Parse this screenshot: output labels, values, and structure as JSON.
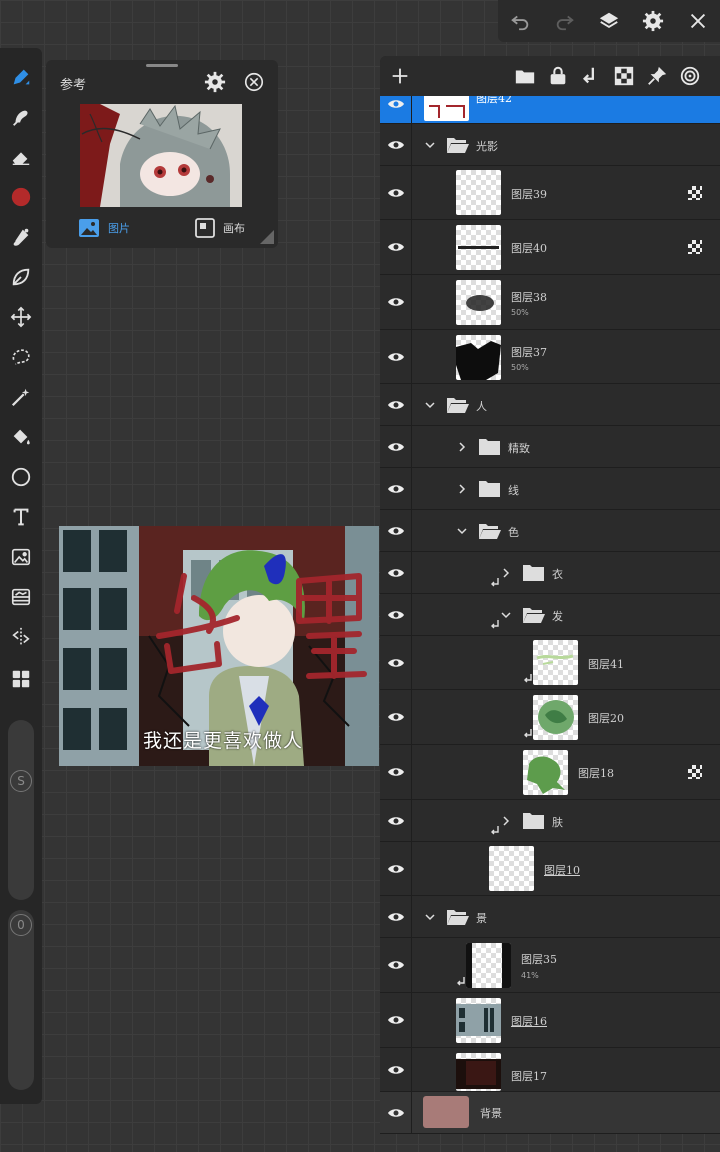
{
  "topbar": {
    "icons": [
      "undo-icon",
      "redo-icon",
      "layers-icon",
      "gear-icon",
      "close-icon"
    ]
  },
  "tools": [
    "pen-tool-icon",
    "smudge-tool-icon",
    "eraser-tool-icon",
    "color-swatch",
    "brush-tool-icon",
    "liquify-tool-icon",
    "move-tool-icon",
    "lasso-tool-icon",
    "magic-wand-icon",
    "fill-tool-icon",
    "shape-circle-icon",
    "text-tool-icon",
    "import-image-icon",
    "adjust-icon",
    "symmetry-icon",
    "grid-icon"
  ],
  "colors": {
    "accent": "#1b7be3",
    "brush_color": "#b32a2a",
    "background_layer": "#a87b78"
  },
  "sliders": {
    "size_label": "S",
    "opacity_label": "0"
  },
  "reference": {
    "title": "参考",
    "tabs": [
      {
        "label": "图片"
      },
      {
        "label": "画布"
      }
    ]
  },
  "artwork": {
    "caption": "我还是更喜欢做人"
  },
  "layers": {
    "selected_name": "图层42",
    "rows": [
      {
        "name": "光影",
        "sub": ""
      },
      {
        "name": "图层39",
        "sub": ""
      },
      {
        "name": "图层40",
        "sub": ""
      },
      {
        "name": "图层38",
        "sub": "50%"
      },
      {
        "name": "图层37",
        "sub": "50%"
      },
      {
        "name": "人",
        "sub": ""
      },
      {
        "name": "精致",
        "sub": ""
      },
      {
        "name": "线",
        "sub": ""
      },
      {
        "name": "色",
        "sub": ""
      },
      {
        "name": "衣",
        "sub": ""
      },
      {
        "name": "发",
        "sub": ""
      },
      {
        "name": "图层41",
        "sub": ""
      },
      {
        "name": "图层20",
        "sub": ""
      },
      {
        "name": "图层18",
        "sub": ""
      },
      {
        "name": "肤",
        "sub": ""
      },
      {
        "name": "图层10",
        "sub": ""
      },
      {
        "name": "景",
        "sub": ""
      },
      {
        "name": "图层35",
        "sub": "41%"
      },
      {
        "name": "图层16",
        "sub": ""
      },
      {
        "name": "图层17",
        "sub": ""
      },
      {
        "name": "背景",
        "sub": ""
      }
    ]
  }
}
